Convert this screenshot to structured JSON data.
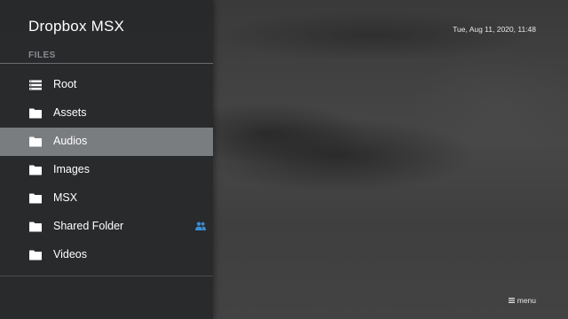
{
  "app": {
    "title": "Dropbox MSX"
  },
  "section": {
    "label": "FILES"
  },
  "items": [
    {
      "label": "Root",
      "icon": "list-icon"
    },
    {
      "label": "Assets",
      "icon": "folder-icon"
    },
    {
      "label": "Audios",
      "icon": "folder-icon",
      "selected": true
    },
    {
      "label": "Images",
      "icon": "folder-icon"
    },
    {
      "label": "MSX",
      "icon": "folder-icon"
    },
    {
      "label": "Shared Folder",
      "icon": "folder-icon",
      "badge_icon": "people-icon"
    },
    {
      "label": "Videos",
      "icon": "folder-icon"
    }
  ],
  "status": {
    "datetime": "Tue, Aug 11, 2020, 11:48"
  },
  "footer": {
    "menu_label": "menu",
    "menu_icon": "hamburger-icon"
  },
  "colors": {
    "selected_row": "#7a7d80",
    "shared_icon": "#3a8fd6",
    "sidebar_bg": "#26282a"
  }
}
